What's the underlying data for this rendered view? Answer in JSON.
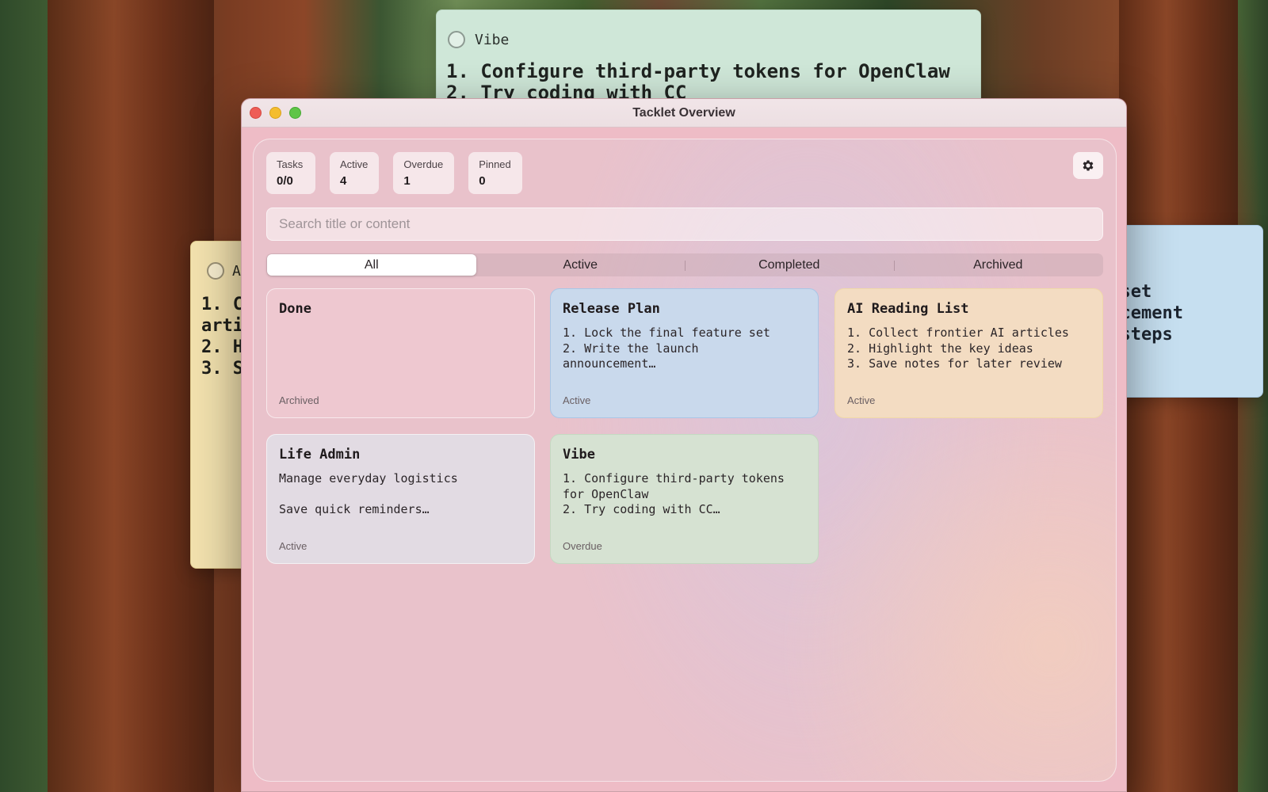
{
  "background_notes": {
    "green": {
      "title": "Vibe",
      "body": "1. Configure third-party tokens for OpenClaw\n2. Try coding with CC"
    },
    "yellow": {
      "title": "A",
      "body": "1. C\narti\n2. H\n3. S"
    },
    "blue": {
      "body": "e set\nuncement\ne steps"
    }
  },
  "window": {
    "title": "Tacklet Overview"
  },
  "stats": [
    {
      "label": "Tasks",
      "value": "0/0"
    },
    {
      "label": "Active",
      "value": "4"
    },
    {
      "label": "Overdue",
      "value": "1"
    },
    {
      "label": "Pinned",
      "value": "0"
    }
  ],
  "settings": {
    "icon": "gear-icon"
  },
  "search": {
    "placeholder": "Search title or content",
    "value": ""
  },
  "filters": {
    "selected": "All",
    "options": [
      "All",
      "Active",
      "Completed",
      "Archived"
    ]
  },
  "cards": [
    {
      "title": "Done",
      "body": "",
      "status": "Archived",
      "color": "#eec8d0"
    },
    {
      "title": "Release Plan",
      "body": "1. Lock the final feature set\n2. Write the launch\nannouncement…",
      "status": "Active",
      "color": "#c9d9ec"
    },
    {
      "title": "AI Reading List",
      "body": "1. Collect frontier AI articles\n2. Highlight the key ideas\n3. Save notes for later review",
      "status": "Active",
      "color": "#f3dcc2"
    },
    {
      "title": "Life Admin",
      "body": "Manage everyday logistics\n\nSave quick reminders…",
      "status": "Active",
      "color": "#e2dbe3"
    },
    {
      "title": "Vibe",
      "body": "1. Configure third-party tokens\nfor OpenClaw\n2. Try coding with CC…",
      "status": "Overdue",
      "color": "#d6e2d2"
    }
  ]
}
